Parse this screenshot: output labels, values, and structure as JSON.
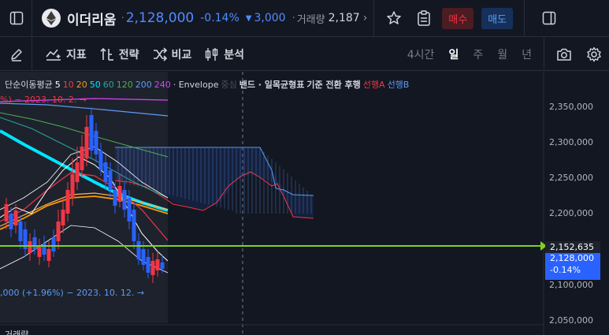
{
  "header": {
    "coin_name": "이더리움",
    "price": "2,128,000",
    "change_pct": "-0.14%",
    "change_amount": "3,000",
    "volume_label": "거래량",
    "volume_value": "2,187",
    "buy_label": "매수",
    "sell_label": "매도"
  },
  "toolbar": {
    "indicators_label": "지표",
    "strategy_label": "전략",
    "compare_label": "비교",
    "analysis_label": "분석",
    "timeframes": [
      "4시간",
      "일",
      "주",
      "월",
      "년"
    ],
    "active_timeframe": "일"
  },
  "legend": {
    "ma_label": "단순이동평균",
    "ma_periods": [
      "5",
      "10",
      "20",
      "50",
      "60",
      "120",
      "200",
      "240"
    ],
    "envelope_label": "· Envelope",
    "center_label": "중심",
    "band_label": "밴드 · 일목균형표",
    "ichimoku_terms": "기준 전환 후행",
    "span_a": "선행A",
    "span_b": "선행B",
    "high_note": "%) − 2023. 10. 2. →",
    "low_note": ",000 (+1.96%) − 2023. 10. 12. →",
    "volume_pane_label": "거래량"
  },
  "price_axis": {
    "ticks": [
      "2,350,000",
      "2,300,000",
      "2,250,000",
      "2,200,000",
      "2,100,000",
      "2,050,000"
    ],
    "alert_price": "2,152,635",
    "current_price": "2,128,000",
    "current_change": "-0.14%"
  },
  "colors": {
    "background": "#131722",
    "up": "#f23645",
    "down": "#2962ff",
    "accent_blue": "#4f8cff",
    "alert_line": "#7ed321",
    "ma5": "#ffffff",
    "ma10": "#f23645",
    "ma20": "#ff9800",
    "ma50": "#00e5ff",
    "ma60": "#26a69a",
    "ma120": "#4caf50",
    "ma200": "#5b9cf6",
    "ma240": "#e040fb"
  }
}
